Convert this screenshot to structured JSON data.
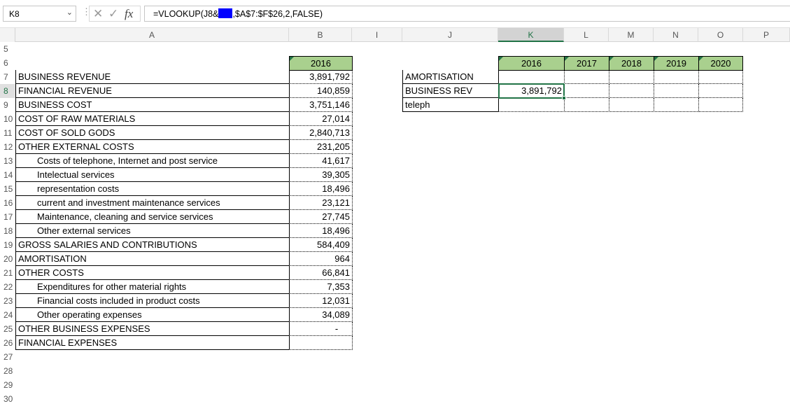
{
  "name_box": "K8",
  "formula": {
    "prefix": "=VLOOKUP(J8&",
    "suffix": ",$A$7:$F$26,2,FALSE)"
  },
  "icons": {
    "cancel": "✕",
    "enter": "✓",
    "fx": "fx",
    "dropdown": "⌄",
    "dots": "⋮"
  },
  "columns": [
    "A",
    "B",
    "I",
    "J",
    "K",
    "L",
    "M",
    "N",
    "O",
    "P"
  ],
  "rows": [
    "5",
    "6",
    "7",
    "8",
    "9",
    "10",
    "11",
    "12",
    "13",
    "14",
    "15",
    "16",
    "17",
    "18",
    "19",
    "20",
    "21",
    "22",
    "23",
    "24",
    "25",
    "26",
    "27",
    "28",
    "29",
    "30"
  ],
  "table_left": {
    "header": "2016",
    "items": [
      {
        "label": "BUSINESS REVENUE",
        "value": "3,891,792"
      },
      {
        "label": "FINANCIAL REVENUE",
        "value": "140,859"
      },
      {
        "label": "BUSINESS COST",
        "value": "3,751,146"
      },
      {
        "label": "COST OF RAW MATERIALS",
        "value": "27,014"
      },
      {
        "label": "COST OF SOLD GODS",
        "value": "2,840,713"
      },
      {
        "label": "OTHER EXTERNAL COSTS",
        "value": "231,205"
      },
      {
        "label": "Costs of telephone, Internet and post service",
        "value": "41,617"
      },
      {
        "label": "Intelectual services",
        "value": "39,305"
      },
      {
        "label": "representation costs",
        "value": "18,496"
      },
      {
        "label": "current and investment maintenance services",
        "value": "23,121"
      },
      {
        "label": "Maintenance, cleaning and service services",
        "value": "27,745"
      },
      {
        "label": "Other external services",
        "value": "18,496"
      },
      {
        "label": "GROSS SALARIES AND CONTRIBUTIONS",
        "value": "584,409"
      },
      {
        "label": "AMORTISATION",
        "value": "964"
      },
      {
        "label": "OTHER COSTS",
        "value": "66,841"
      },
      {
        "label": "Expenditures for other material rights",
        "value": "7,353"
      },
      {
        "label": "Financial costs included in product costs",
        "value": "12,031"
      },
      {
        "label": "Other operating expenses",
        "value": "34,089"
      },
      {
        "label": "OTHER BUSINESS EXPENSES",
        "value": "-"
      },
      {
        "label": "FINANCIAL EXPENSES",
        "value": ""
      }
    ]
  },
  "table_right": {
    "years": [
      "2016",
      "2017",
      "2018",
      "2019",
      "2020"
    ],
    "rows": [
      {
        "label": "AMORTISATION",
        "values": [
          "",
          "",
          "",
          "",
          ""
        ]
      },
      {
        "label": "BUSINESS REV",
        "values": [
          "3,891,792",
          "",
          "",
          "",
          ""
        ]
      },
      {
        "label": "teleph",
        "values": [
          "",
          "",
          "",
          "",
          ""
        ]
      }
    ]
  }
}
